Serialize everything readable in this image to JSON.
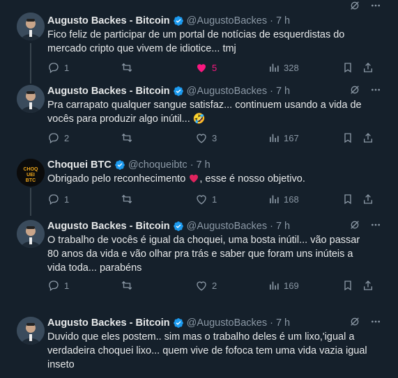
{
  "tweets": [
    {
      "name": "Augusto Backes - Bitcoin",
      "handle": "@AugustoBackes",
      "time": "7 h",
      "text": "Fico feliz de participar de um portal de notícias de esquerdistas do mercado cripto que vivem de idiotice... tmj",
      "replies": "1",
      "retweets": "",
      "likes": "5",
      "views": "328",
      "liked": true,
      "avatar_icon": "person-avatar-icon"
    },
    {
      "name": "Augusto Backes - Bitcoin",
      "handle": "@AugustoBackes",
      "time": "7 h",
      "text": "Pra carrapato qualquer sangue satisfaz... continuem usando a vida de vocês para produzir algo inútil...",
      "emoji": "🤣",
      "replies": "2",
      "retweets": "",
      "likes": "3",
      "views": "167",
      "liked": false,
      "avatar_icon": "person-avatar-icon"
    },
    {
      "name": "Choquei BTC",
      "handle": "@choqueibtc",
      "time": "7 h",
      "text_before": "Obrigado pelo reconhecimento",
      "text_after": ", esse é nosso objetivo.",
      "replies": "1",
      "retweets": "",
      "likes": "1",
      "views": "168",
      "liked": false,
      "avatar_text": "CHOQUEI BTC"
    },
    {
      "name": "Augusto Backes - Bitcoin",
      "handle": "@AugustoBackes",
      "time": "7 h",
      "text": "O trabalho de vocês é igual da choquei, uma bosta inútil... vão passar 80 anos da vida e vão olhar pra trás e saber que foram uns inúteis a vida toda... parabéns",
      "replies": "1",
      "retweets": "",
      "likes": "2",
      "views": "169",
      "liked": false,
      "avatar_icon": "person-avatar-icon"
    },
    {
      "name": "Augusto Backes - Bitcoin",
      "handle": "@AugustoBackes",
      "time": "7 h",
      "text": "Duvido que eles postem.. sim mas o trabalho deles é um lixo,'igual a verdadeira choquei lixo... quem vive de fofoca tem uma vida vazia igual inseto",
      "avatar_icon": "person-avatar-icon"
    }
  ],
  "colors": {
    "background": "#15202b",
    "text": "#e7e9ea",
    "muted": "#8b98a5",
    "like": "#f91880",
    "verified": "#1d9bf0",
    "thread_line": "#38444d"
  }
}
